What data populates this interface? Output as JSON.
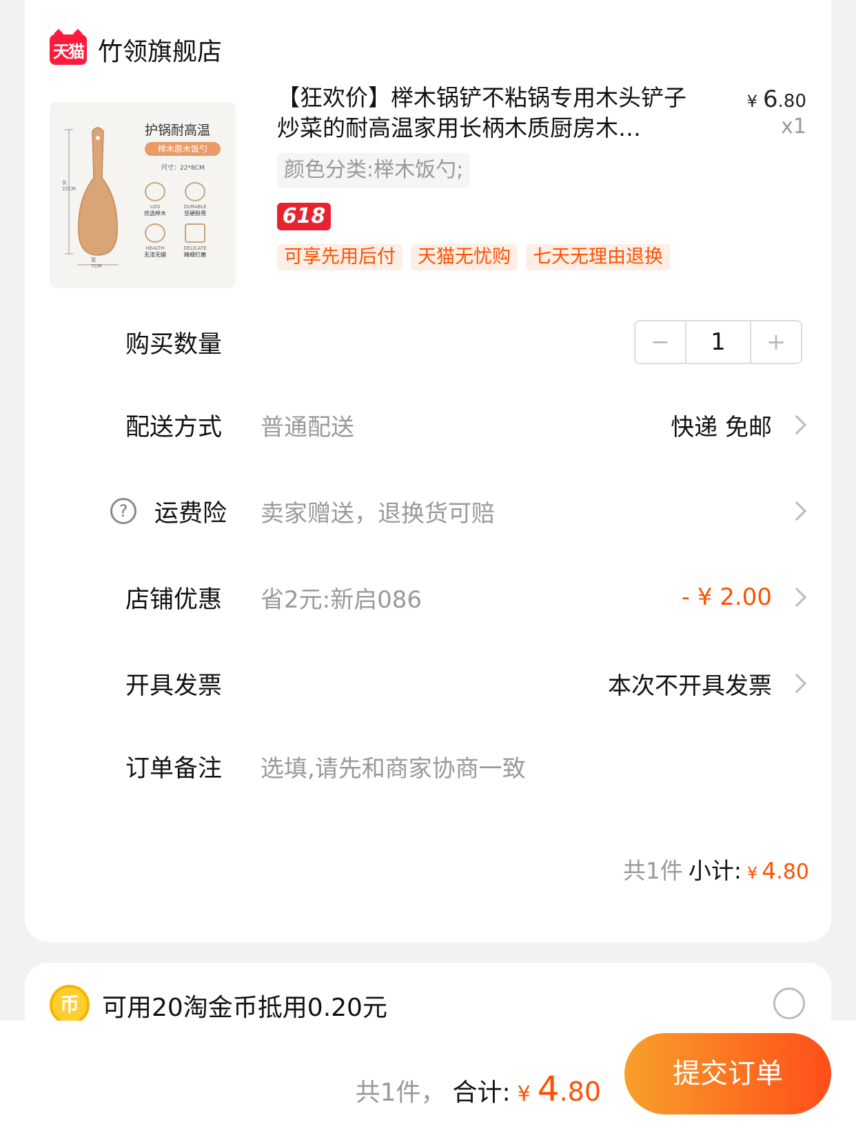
{
  "shop": {
    "logo_text": "天猫",
    "name": "竹领旗舰店"
  },
  "product": {
    "title": "【狂欢价】榉木锅铲不粘锅专用木头铲子炒菜的耐高温家用长柄木质厨房木…",
    "price_currency": "¥",
    "price_int": "6",
    "price_dec": ".80",
    "quantity": "x1",
    "sku": "颜色分类:榉木饭勺;",
    "promo_badge": "618",
    "tags": [
      "可享先用后付",
      "天猫无忧购",
      "七天无理由退换"
    ],
    "image": {
      "title": "护锅耐高温",
      "tag": "榉木原木饭勺",
      "size": "尺寸：22*8CM",
      "features": [
        {
          "en": "LOG",
          "cn": "优选榉木"
        },
        {
          "en": "DURABLE",
          "cn": "坚硬耐用"
        },
        {
          "en": "HEALTH",
          "cn": "无漆无蜡"
        },
        {
          "en": "DELICATE",
          "cn": "精细打磨"
        }
      ],
      "length_label": "长\n22CM",
      "width_label": "宽\n7CM"
    }
  },
  "quantity_row": {
    "label": "购买数量",
    "value": "1",
    "minus": "−",
    "plus": "+"
  },
  "delivery_row": {
    "label": "配送方式",
    "value": "普通配送",
    "right": "快递 免邮"
  },
  "insurance_row": {
    "help": "?",
    "label": "运费险",
    "value": "卖家赠送，退换货可赔"
  },
  "discount_row": {
    "label": "店铺优惠",
    "value": "省2元:新启086",
    "right": "- ¥ 2.00"
  },
  "invoice_row": {
    "label": "开具发票",
    "right": "本次不开具发票"
  },
  "note_row": {
    "label": "订单备注",
    "placeholder": "选填,请先和商家协商一致"
  },
  "subtotal": {
    "count": "共1件",
    "label": "小计:",
    "currency": "¥",
    "int": "4",
    "dec": ".80"
  },
  "coin": {
    "icon": "币",
    "text": "可用20淘金币抵用0.20元"
  },
  "bottom": {
    "count": "共1件，",
    "label": "合计:",
    "currency": "¥",
    "int": "4",
    "dec": ".80",
    "submit": "提交订单"
  }
}
